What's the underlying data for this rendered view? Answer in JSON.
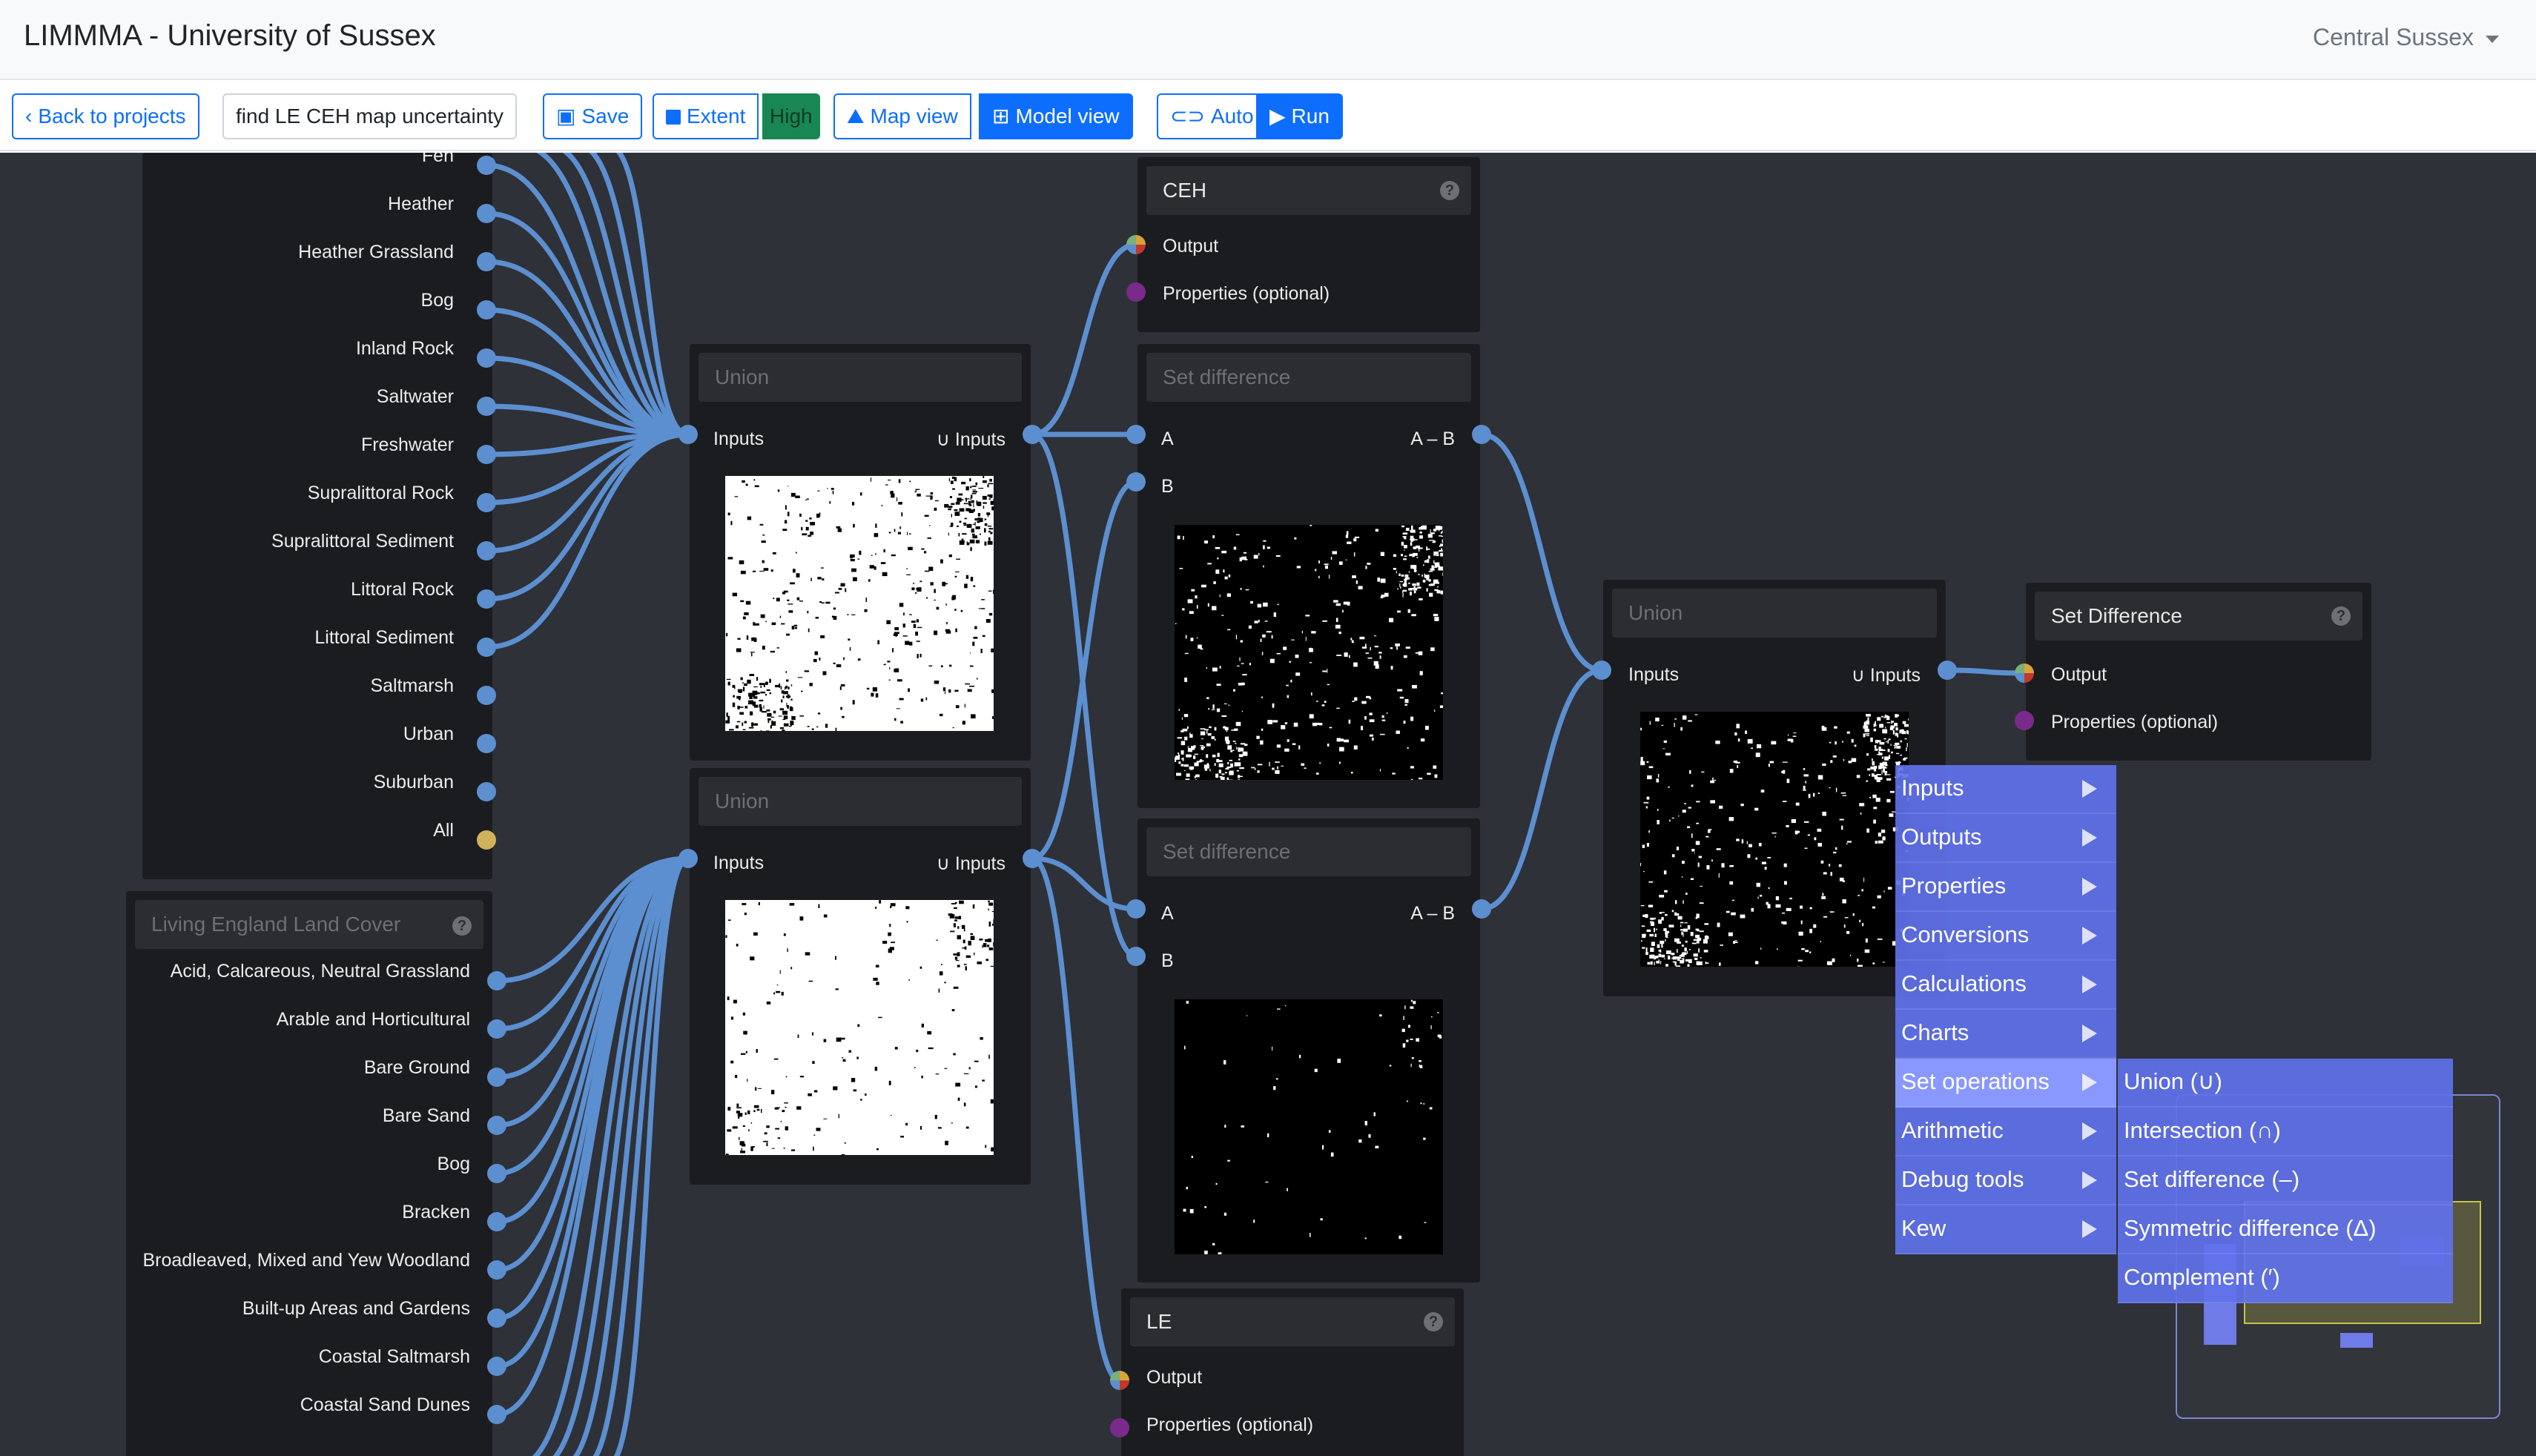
{
  "header": {
    "title": "LIMMMA - University of Sussex",
    "region": "Central Sussex"
  },
  "toolbar": {
    "back": "Back to projects",
    "project_name": "find LE CEH map uncertainty",
    "save": "Save",
    "extent": "Extent",
    "quality": "High",
    "map_view": "Map view",
    "model_view": "Model view",
    "auto": "Auto",
    "run": "Run"
  },
  "ceh_outputs": [
    "Fen",
    "Heather",
    "Heather Grassland",
    "Bog",
    "Inland Rock",
    "Saltwater",
    "Freshwater",
    "Supralittoral Rock",
    "Supralittoral Sediment",
    "Littoral Rock",
    "Littoral Sediment",
    "Saltmarsh",
    "Urban",
    "Suburban",
    "All"
  ],
  "le_node": {
    "title": "Living England Land Cover",
    "outputs": [
      "Acid, Calcareous, Neutral Grassland",
      "Arable and Horticultural",
      "Bare Ground",
      "Bare Sand",
      "Bog",
      "Bracken",
      "Broadleaved, Mixed and Yew Woodland",
      "Built-up Areas and Gardens",
      "Coastal Saltmarsh",
      "Coastal Sand Dunes"
    ]
  },
  "nodes": {
    "union": {
      "title": "Union",
      "input": "Inputs",
      "output": "∪ Inputs"
    },
    "ceh": {
      "title": "CEH",
      "output": "Output",
      "properties": "Properties (optional)"
    },
    "le": {
      "title": "LE",
      "output": "Output",
      "properties": "Properties (optional)"
    },
    "setdiff": {
      "title": "Set difference",
      "a": "A",
      "b": "B",
      "output": "A – B"
    },
    "setdiff_out": {
      "title": "Set Difference",
      "output": "Output",
      "properties": "Properties (optional)"
    }
  },
  "menu": {
    "items": [
      "Inputs",
      "Outputs",
      "Properties",
      "Conversions",
      "Calculations",
      "Charts",
      "Set operations",
      "Arithmetic",
      "Debug tools",
      "Kew"
    ],
    "highlighted": "Set operations",
    "submenu": [
      "Union (∪)",
      "Intersection (∩)",
      "Set difference (–)",
      "Symmetric difference (Δ)",
      "Complement (′)"
    ]
  },
  "colors": {
    "accent": "#0d6efd",
    "canvas": "#2e3137",
    "wire": "#5c8fd0",
    "menu": "#6071ec",
    "quality": "#198754"
  }
}
